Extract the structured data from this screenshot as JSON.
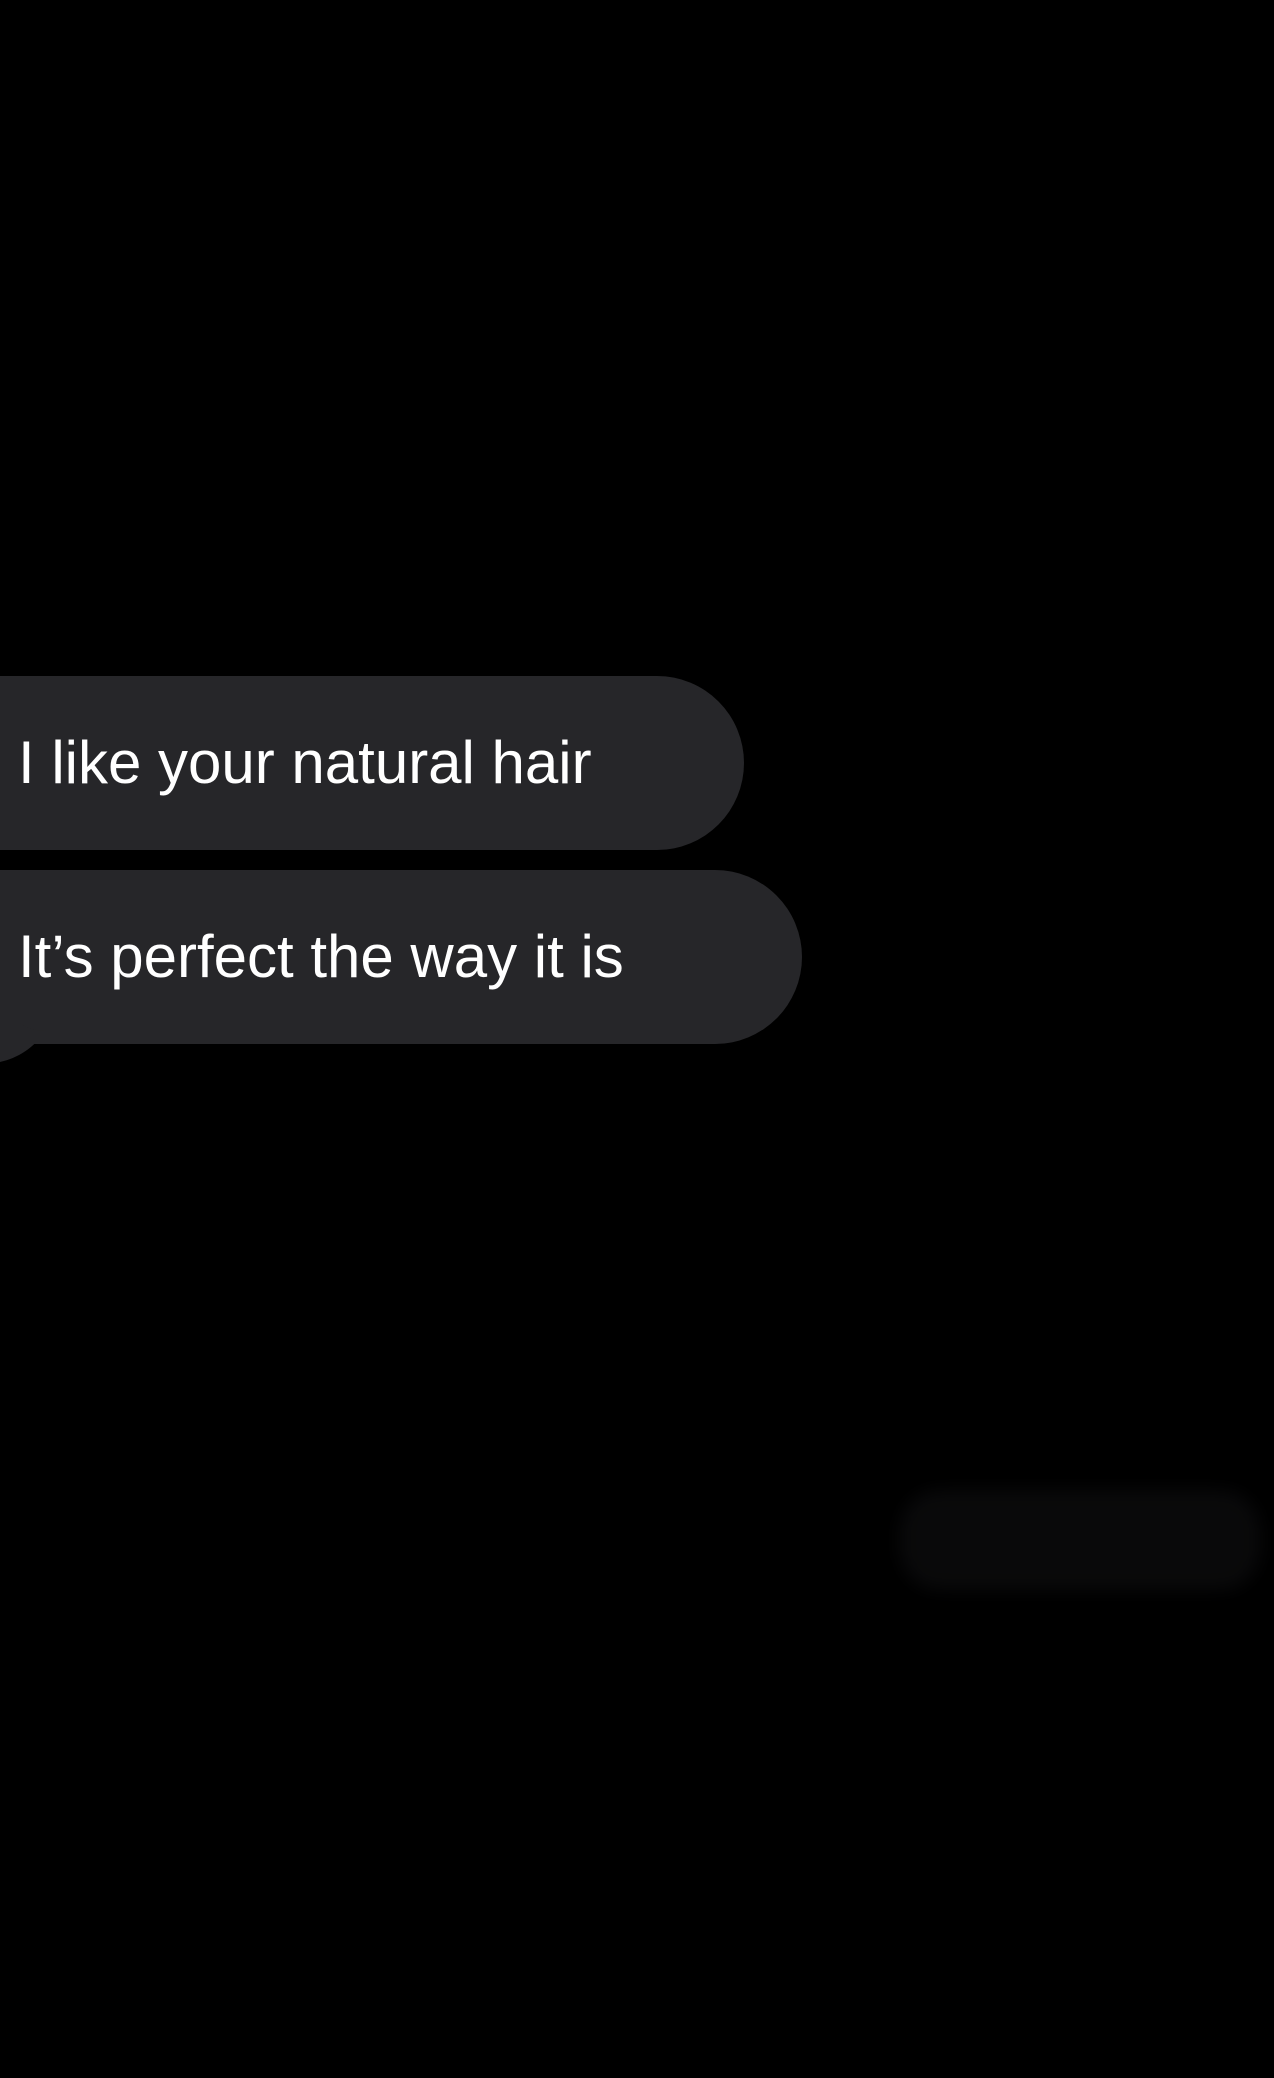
{
  "conversation": {
    "messages": [
      {
        "text": "I like your natural hair"
      },
      {
        "text": "It’s perfect the way it is"
      }
    ]
  },
  "colors": {
    "background": "#000000",
    "incoming_bubble": "#262629",
    "text": "#ffffff"
  }
}
